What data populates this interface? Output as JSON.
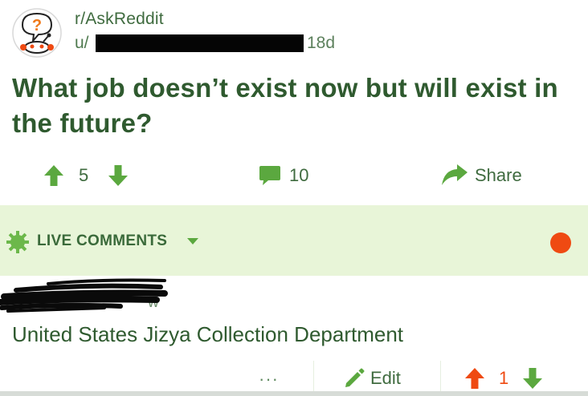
{
  "post": {
    "subreddit": "r/AskReddit",
    "user_prefix": "u/",
    "age": "18d",
    "title": "What job doesn’t exist now but will exist in the future?",
    "score": "5",
    "comment_count": "10",
    "share_label": "Share",
    "icons": {
      "avatar": "askreddit-snoo-icon",
      "upvote": "arrow-up-icon",
      "downvote": "arrow-down-icon",
      "comments": "comment-bubble-icon",
      "share": "share-arrow-icon"
    }
  },
  "live": {
    "label": "LIVE COMMENTS",
    "icon": "gear-icon",
    "chevron": "chevron-down-icon",
    "indicator_color": "#ef4a12"
  },
  "comment": {
    "age_fragment": "w",
    "body": "United States Jizya Collection Department",
    "more_label": "···",
    "edit_label": "Edit",
    "score": "1",
    "icons": {
      "edit": "pencil-icon",
      "upvote": "arrow-up-icon",
      "downvote": "arrow-down-icon"
    }
  },
  "colors": {
    "text": "#2f5a2f",
    "accent": "#5ba83f",
    "live_background": "#e8f5d8",
    "upvoted": "#ef4a12"
  }
}
